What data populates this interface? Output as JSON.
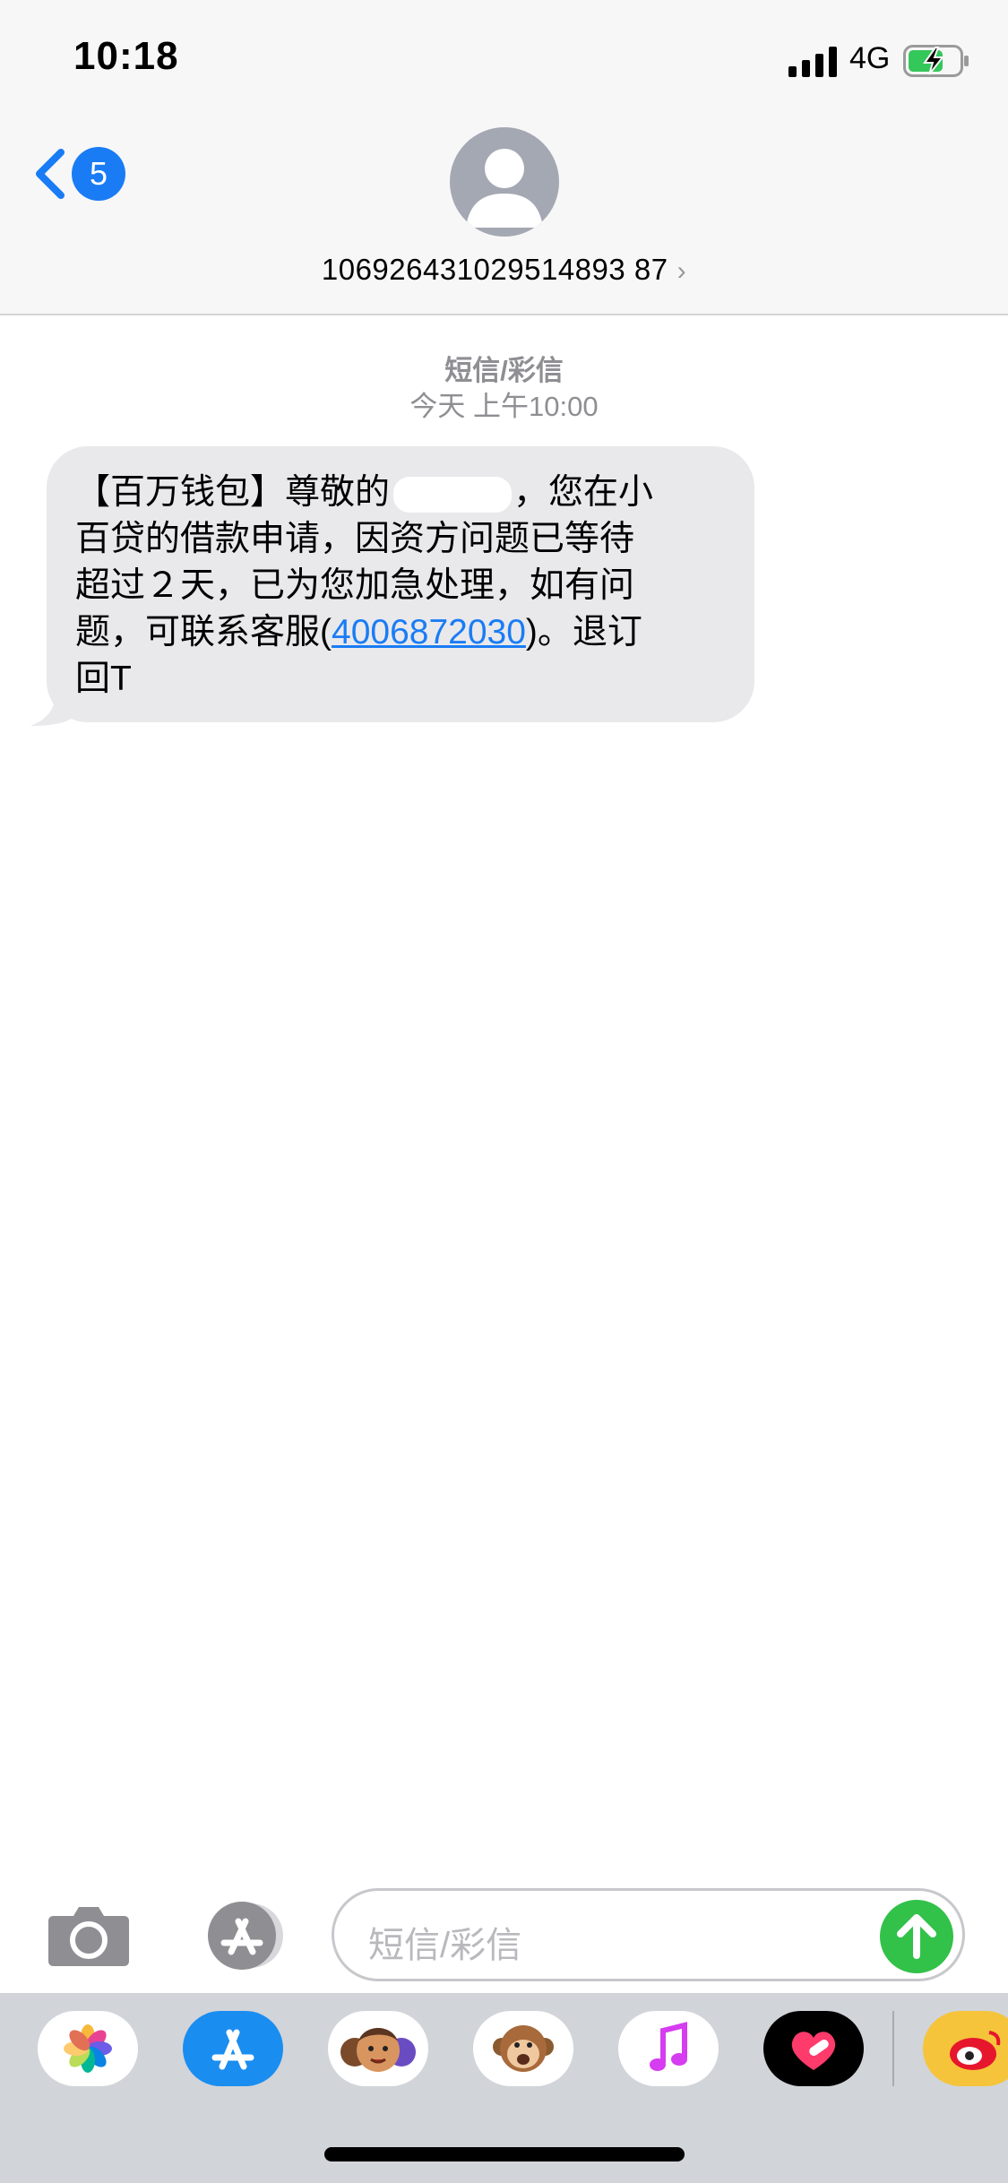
{
  "status_bar": {
    "time": "10:18",
    "network": "4G"
  },
  "nav": {
    "back_count": "5",
    "contact": "106926431029514893 87",
    "contact_chevron": "›"
  },
  "conversation": {
    "type": "短信/彩信",
    "timestamp": "今天 上午10:00"
  },
  "message": {
    "line1_pre": "【百万钱包】尊敬的",
    "line1_post": "，您在小",
    "line2": "百贷的借款申请，因资方问题已等待",
    "line3": "超过２天，已为您加急处理，如有问",
    "line4_pre": "题，可联系客服(",
    "phone": "4006872030",
    "line4_post": ")。退订",
    "line5": "回T"
  },
  "input": {
    "placeholder": "短信/彩信"
  },
  "app_strip": [
    {
      "name": "photos",
      "bg": "#ffffff"
    },
    {
      "name": "app-store",
      "bg": "#1a8df0"
    },
    {
      "name": "memoji",
      "bg": "#ffffff"
    },
    {
      "name": "animoji",
      "bg": "#ffffff"
    },
    {
      "name": "music",
      "bg": "#ffffff"
    },
    {
      "name": "digital-touch",
      "bg": "#000000"
    },
    {
      "name": "weibo",
      "bg": "#f5c43a"
    }
  ],
  "colors": {
    "accent": "#1a7cf5",
    "send": "#32c149",
    "bubble": "#e9e9eb"
  }
}
